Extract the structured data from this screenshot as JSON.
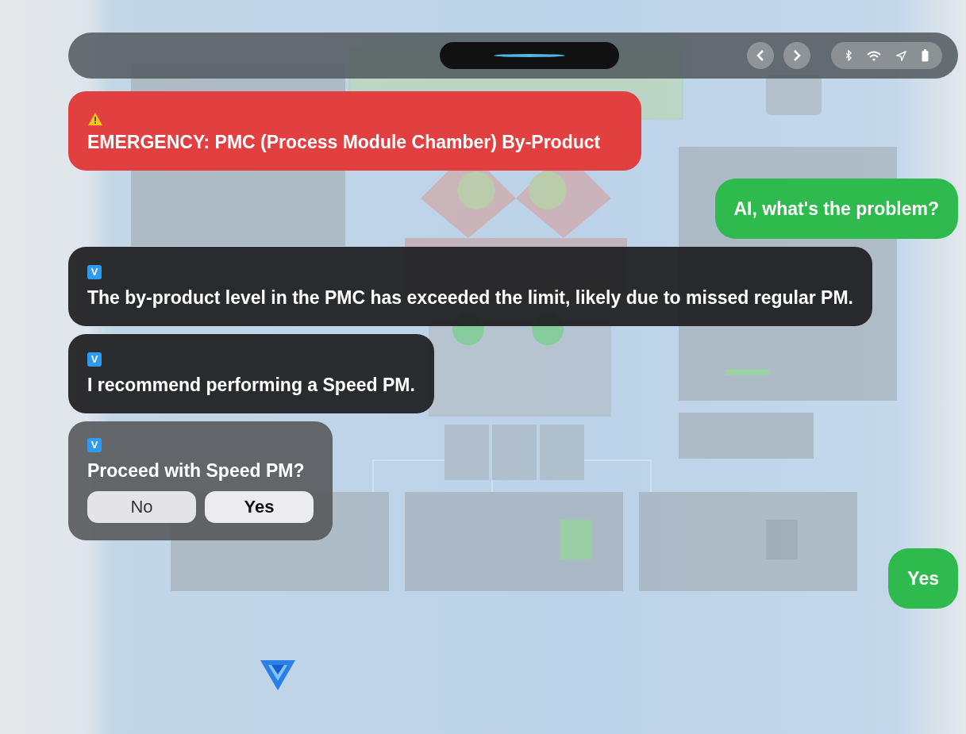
{
  "messages": [
    {
      "kind": "alert",
      "text": "EMERGENCY: PMC (Process Module Chamber) By-Product"
    },
    {
      "kind": "user",
      "text": "AI, what's the problem?"
    },
    {
      "kind": "ai",
      "badge": "V",
      "text": "The by-product level in the PMC has exceeded the limit, likely due to missed regular PM."
    },
    {
      "kind": "ai",
      "badge": "V",
      "text": "I recommend performing a Speed PM."
    },
    {
      "kind": "question",
      "badge": "V",
      "text": "Proceed with Speed PM?",
      "buttons": [
        "No",
        "Yes"
      ]
    },
    {
      "kind": "user",
      "text": "Yes"
    }
  ]
}
